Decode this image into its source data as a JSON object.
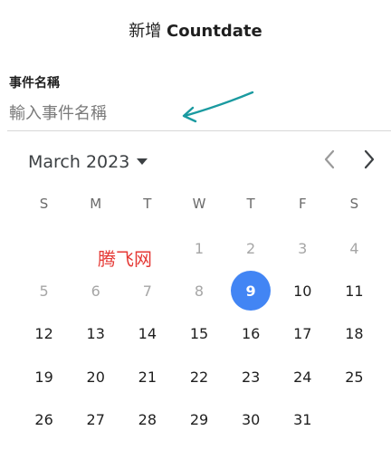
{
  "header": {
    "title_prefix": "新增",
    "title_brand": "Countdate"
  },
  "name_field": {
    "label": "事件名稱",
    "placeholder": "輸入事件名稱",
    "value": ""
  },
  "calendar": {
    "month_label": "March 2023",
    "prev_icon": "chevron-left-icon",
    "next_icon": "chevron-right-icon",
    "dropdown_icon": "caret-down-icon",
    "weekdays": [
      "S",
      "M",
      "T",
      "W",
      "T",
      "F",
      "S"
    ],
    "weeks": [
      [
        "",
        "",
        "",
        "1",
        "2",
        "3",
        "4"
      ],
      [
        "5",
        "6",
        "7",
        "8",
        "9",
        "10",
        "11"
      ],
      [
        "12",
        "13",
        "14",
        "15",
        "16",
        "17",
        "18"
      ],
      [
        "19",
        "20",
        "21",
        "22",
        "23",
        "24",
        "25"
      ],
      [
        "26",
        "27",
        "28",
        "29",
        "30",
        "31",
        ""
      ]
    ],
    "selected_day": "9",
    "past_days": [
      "1",
      "2",
      "3",
      "4",
      "5",
      "6",
      "7",
      "8"
    ]
  },
  "watermark": {
    "text": "腾飞网"
  },
  "colors": {
    "accent": "#4285f4",
    "arrow": "#1a9aa0",
    "watermark": "#e53935"
  }
}
